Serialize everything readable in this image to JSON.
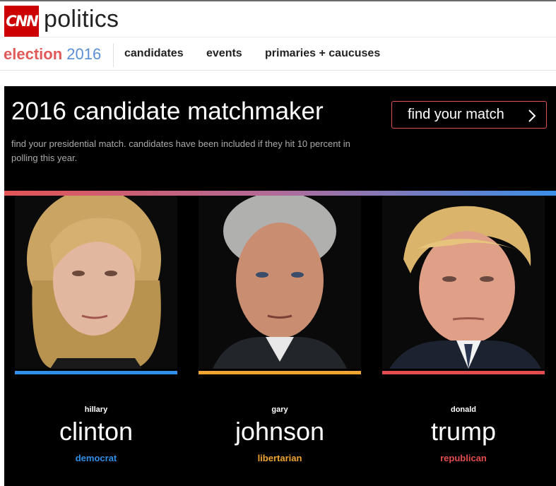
{
  "header": {
    "logo_text": "CNN",
    "section_title": "politics"
  },
  "subnav": {
    "election_word": "election",
    "election_year": "2016",
    "links": [
      "candidates",
      "events",
      "primaries + caucuses"
    ]
  },
  "hero": {
    "title": "2016 candidate matchmaker",
    "description": "find your presidential match. candidates have been included if they hit 10 percent in polling this year.",
    "cta_label": "find your match"
  },
  "candidates": [
    {
      "first": "hillary",
      "last": "clinton",
      "party": "democrat",
      "color": "#2f8fe8"
    },
    {
      "first": "gary",
      "last": "johnson",
      "party": "libertarian",
      "color": "#f0a432"
    },
    {
      "first": "donald",
      "last": "trump",
      "party": "republican",
      "color": "#e34c4c"
    }
  ],
  "colors": {
    "brand_red": "#cc0000",
    "gradient_start": "#e25555",
    "gradient_end": "#3b8ee8"
  }
}
